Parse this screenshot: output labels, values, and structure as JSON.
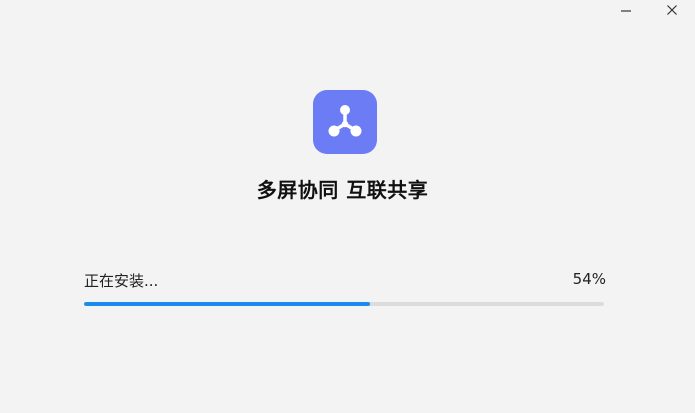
{
  "window": {
    "controls": {
      "minimize_icon": "minimize-icon",
      "close_icon": "close-icon"
    }
  },
  "app": {
    "icon": "hub-share-icon",
    "icon_color": "#6b7cf5"
  },
  "headline": "多屏协同 互联共享",
  "install": {
    "status": "正在安装...",
    "percent_label": "54%",
    "progress": 0.55,
    "accent_color": "#1a8cf0"
  }
}
